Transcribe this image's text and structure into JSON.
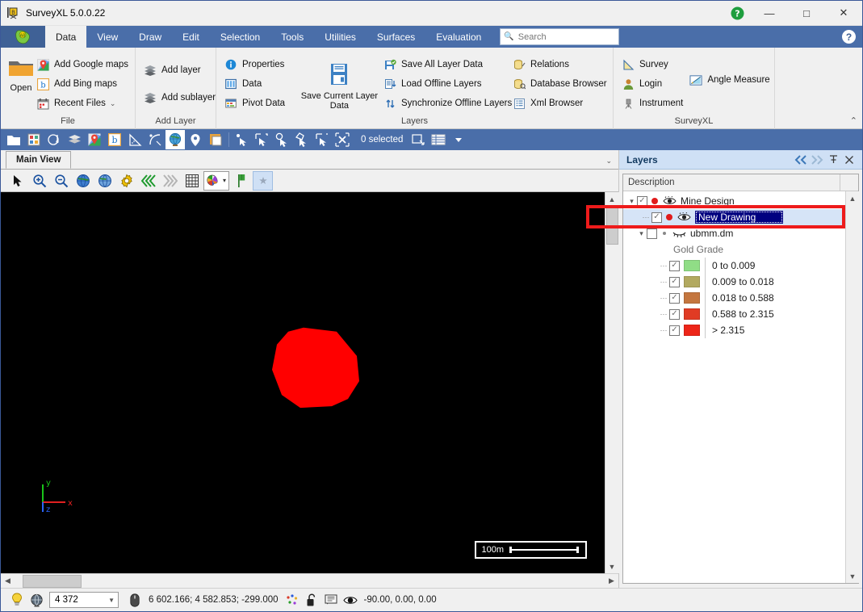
{
  "window": {
    "title": "SurveyXL 5.0.0.22",
    "app_icon": "surveyxl-logo-icon",
    "help_icon": "green-help-icon",
    "minimize": "—",
    "maximize": "□",
    "close": "✕"
  },
  "ribbon": {
    "tabs": [
      {
        "label": "Data",
        "active": true
      },
      {
        "label": "View",
        "active": false
      },
      {
        "label": "Draw",
        "active": false
      },
      {
        "label": "Edit",
        "active": false
      },
      {
        "label": "Selection",
        "active": false
      },
      {
        "label": "Tools",
        "active": false
      },
      {
        "label": "Utilities",
        "active": false
      },
      {
        "label": "Surfaces",
        "active": false
      },
      {
        "label": "Evaluation",
        "active": false
      }
    ],
    "search": {
      "placeholder": "Search",
      "value": ""
    },
    "help_badge": "?",
    "collapse_caret": "⌃",
    "groups": [
      {
        "title": "File",
        "big": {
          "label": "Open",
          "icon": "open-folder-icon"
        },
        "items": [
          {
            "label": "Add Google maps",
            "icon": "google-maps-pin-icon"
          },
          {
            "label": "Add Bing maps",
            "icon": "bing-maps-icon"
          },
          {
            "label": "Recent Files",
            "icon": "recent-files-calendar-icon",
            "caret": "⌄"
          }
        ]
      },
      {
        "title": "Add Layer",
        "items": [
          {
            "label": "Add layer",
            "icon": "layers-stack-icon"
          },
          {
            "label": "Add sublayer",
            "icon": "layers-stack-icon"
          }
        ]
      },
      {
        "title": "Layers",
        "col1": [
          {
            "label": "Properties",
            "icon": "info-circle-icon"
          },
          {
            "label": "Data",
            "icon": "table-grid-icon"
          },
          {
            "label": "Pivot Data",
            "icon": "pivot-table-icon"
          }
        ],
        "big": {
          "label": "Save Current Layer Data",
          "icon": "floppy-save-icon"
        },
        "col2": [
          {
            "label": "Save All Layer Data",
            "icon": "save-all-icon"
          },
          {
            "label": "Load Offline Layers",
            "icon": "load-offline-icon"
          },
          {
            "label": "Synchronize Offline Layers",
            "icon": "sync-arrows-icon"
          }
        ],
        "col3": [
          {
            "label": "Relations",
            "icon": "relations-db-icon"
          },
          {
            "label": "Database Browser",
            "icon": "database-browser-icon"
          },
          {
            "label": "Xml Browser",
            "icon": "xml-browser-icon"
          }
        ]
      },
      {
        "title": "SurveyXL",
        "col1": [
          {
            "label": "Survey",
            "icon": "survey-triangle-icon"
          },
          {
            "label": "Login",
            "icon": "user-login-icon"
          },
          {
            "label": "Instrument",
            "icon": "instrument-icon"
          }
        ],
        "col2": [
          {
            "label": "Angle Measure",
            "icon": "angle-measure-icon"
          }
        ]
      }
    ]
  },
  "quick_toolbar": {
    "selected_text": "0 selected",
    "buttons": [
      {
        "icon": "open-folder-icon"
      },
      {
        "icon": "report-icon"
      },
      {
        "icon": "palette-settings-icon"
      },
      {
        "icon": "layers-stack-icon"
      },
      {
        "icon": "google-maps-pin-icon"
      },
      {
        "icon": "bing-maps-icon",
        "boxed": true
      },
      {
        "icon": "angle-ruler-icon"
      },
      {
        "icon": "curve-icon"
      },
      {
        "icon": "globe-icon",
        "active": true
      },
      {
        "icon": "map-marker-icon"
      },
      {
        "icon": "window-icon"
      },
      {
        "icon": "select-point-icon"
      },
      {
        "icon": "select-rect-icon"
      },
      {
        "icon": "select-circle-icon"
      },
      {
        "icon": "select-polygon-icon"
      },
      {
        "icon": "deselect-rect-icon"
      },
      {
        "icon": "clear-selection-icon"
      }
    ],
    "after_buttons": [
      {
        "icon": "selection-window-icon"
      },
      {
        "icon": "selection-list-icon"
      },
      {
        "icon": "dropdown-caret-icon"
      }
    ]
  },
  "view": {
    "tab_label": "Main View",
    "tab_caret": "⌄",
    "toolbar": [
      {
        "icon": "arrow-cursor-icon"
      },
      {
        "icon": "zoom-in-icon"
      },
      {
        "icon": "zoom-out-icon"
      },
      {
        "icon": "globe-blue-icon"
      },
      {
        "icon": "globe-rotate-icon"
      },
      {
        "icon": "gear-yellow-icon"
      },
      {
        "icon": "rewind-green-icon"
      },
      {
        "icon": "forward-grey-icon"
      },
      {
        "icon": "grid-icon"
      },
      {
        "icon": "color-palette-icon",
        "boxed": true,
        "caret": "▾"
      },
      {
        "icon": "flag-green-icon"
      },
      {
        "icon": "star-icon",
        "selected": true
      }
    ],
    "scalebar_label": "100m",
    "axis": {
      "x": "x",
      "y": "y",
      "z": "z"
    },
    "shape_color": "#ff0000"
  },
  "layers_panel": {
    "title": "Layers",
    "header_icons": [
      {
        "name": "collapse-left-icon",
        "glyph": "◀◀",
        "disabled": false
      },
      {
        "name": "expand-right-icon",
        "glyph": "▶▶",
        "disabled": true
      },
      {
        "name": "pin-icon",
        "glyph": "⍑",
        "disabled": false
      },
      {
        "name": "close-icon",
        "glyph": "✕",
        "disabled": false
      }
    ],
    "column_header": "Description",
    "tree": [
      {
        "label": "Mine Design",
        "level": 0,
        "checked": true,
        "dot": "red",
        "eye": "open",
        "twisty": "expanded"
      },
      {
        "label": "New Drawing",
        "level": 1,
        "checked": true,
        "dot": "red",
        "eye": "open",
        "selected": true
      },
      {
        "label": "ubmm.dm",
        "level": 1,
        "checked": false,
        "dot": "grey",
        "eye": "closed",
        "twisty": "expanded"
      },
      {
        "label": "Gold Grade",
        "level": 2,
        "kind": "caption"
      }
    ],
    "legend": [
      {
        "label": "0 to 0.009",
        "color": "#90dd86"
      },
      {
        "label": "0.009 to 0.018",
        "color": "#b2a95f"
      },
      {
        "label": "0.018 to 0.588",
        "color": "#c4763f"
      },
      {
        "label": "0.588 to 2.315",
        "color": "#e03b24"
      },
      {
        "label": "> 2.315",
        "color": "#ed2518"
      }
    ]
  },
  "status_bar": {
    "bulb_icon": "light-bulb-icon",
    "globe_icon": "globe-grey-icon",
    "scale_value": "4 372",
    "mouse_icon": "mouse-icon",
    "coordinates": "6 602.166; 4 582.853; -299.000",
    "snap_icon": "snap-points-icon",
    "lock_icon": "unlock-icon",
    "note_icon": "tooltip-icon",
    "eye_icon": "eye-view-icon",
    "orientation": "-90.00, 0.00, 0.00"
  },
  "annotation": {
    "color": "#ee1b1b"
  }
}
